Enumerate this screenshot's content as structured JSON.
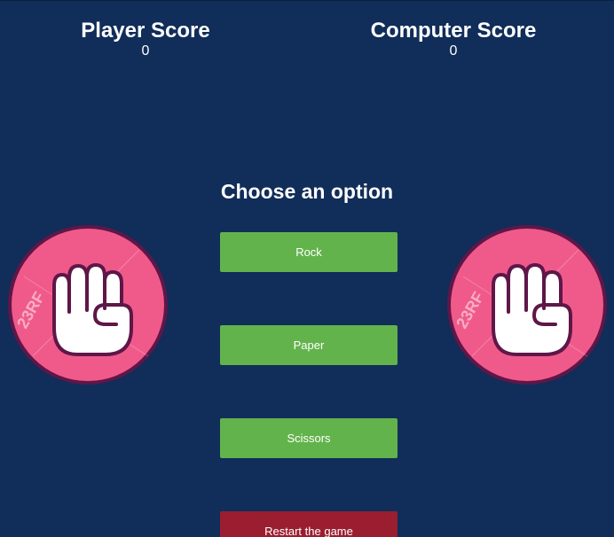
{
  "scores": {
    "player": {
      "title": "Player Score",
      "value": "0"
    },
    "computer": {
      "title": "Computer Score",
      "value": "0"
    }
  },
  "prompt": "Choose an option",
  "buttons": {
    "rock": "Rock",
    "paper": "Paper",
    "scissors": "Scissors",
    "restart": "Restart the game"
  },
  "hands": {
    "player": {
      "icon": "fist-icon",
      "watermark": "23RF"
    },
    "computer": {
      "icon": "fist-icon",
      "watermark": "23RF"
    }
  },
  "colors": {
    "background": "#112d59",
    "choice_button": "#63b34c",
    "restart_button": "#9a1e30",
    "hand_circle": "#f05a8a",
    "hand_outline": "#5e1748"
  }
}
